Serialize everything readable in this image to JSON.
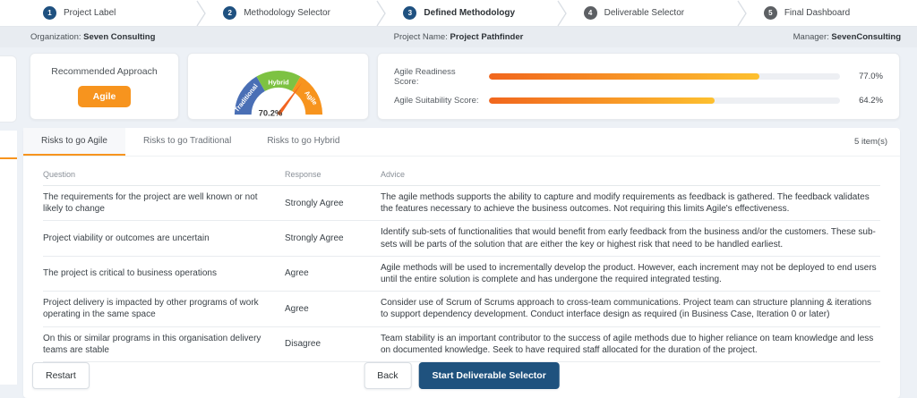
{
  "stepper": {
    "steps": [
      {
        "number": "1",
        "label": "Project Label"
      },
      {
        "number": "2",
        "label": "Methodology Selector"
      },
      {
        "number": "3",
        "label": "Defined Methodology"
      },
      {
        "number": "4",
        "label": "Deliverable Selector"
      },
      {
        "number": "5",
        "label": "Final Dashboard"
      }
    ],
    "active_index": 2
  },
  "info_bar": {
    "org_label": "Organization:",
    "org_value": "Seven Consulting",
    "project_label": "Project Name:",
    "project_value": "Project Pathfinder",
    "manager_label": "Manager:",
    "manager_value": "SevenConsulting"
  },
  "cards": {
    "recommended": {
      "title": "Recommended Approach",
      "badge": "Agile",
      "badge_color": "#f7941e"
    },
    "gauge": {
      "value": 70.2,
      "value_label": "70.2%",
      "segments": [
        {
          "label": "Traditional",
          "color": "#4a6fb5"
        },
        {
          "label": "Hybrid",
          "color": "#7dc242"
        },
        {
          "label": "Agile",
          "color": "#f7941e"
        }
      ]
    },
    "scores": {
      "items": [
        {
          "label": "Agile Readiness Score:",
          "value_label": "77.0%",
          "percent": 77.0,
          "width_css": "77%"
        },
        {
          "label": "Agile Suitability Score:",
          "value_label": "64.2%",
          "percent": 64.2,
          "width_css": "64.2%"
        }
      ]
    }
  },
  "tabs": {
    "items": [
      {
        "label": "Risks to go Agile"
      },
      {
        "label": "Risks to go Traditional"
      },
      {
        "label": "Risks to go Hybrid"
      }
    ],
    "active_index": 0,
    "count_label": "5 item(s)"
  },
  "table": {
    "headers": {
      "question": "Question",
      "response": "Response",
      "advice": "Advice"
    },
    "rows": [
      {
        "question": "The requirements for the project are well known or not likely to change",
        "response": "Strongly Agree",
        "advice": "The agile methods supports the ability to capture and modify requirements as feedback is gathered. The feedback validates the features necessary to achieve the business outcomes. Not requiring this limits Agile's effectiveness."
      },
      {
        "question": "Project viability or outcomes are uncertain",
        "response": "Strongly Agree",
        "advice": "Identify sub-sets of functionalities that would benefit from early feedback from the business and/or the customers. These sub-sets will be parts of the solution that are either the key or highest risk that need to be handled earliest."
      },
      {
        "question": "The project is critical to business operations",
        "response": "Agree",
        "advice": "Agile methods will be used to incrementally develop the product. However, each increment may not be deployed to end users until the entire solution is complete and has undergone the required integrated testing."
      },
      {
        "question": "Project delivery is impacted by other programs of work operating in the same space",
        "response": "Agree",
        "advice": "Consider use of Scrum of Scrums approach to cross-team communications. Project team can structure planning & iterations to support dependency development. Conduct interface design as required (in Business Case, Iteration 0 or later)"
      },
      {
        "question": "On this or similar programs in this organisation delivery teams are stable",
        "response": "Disagree",
        "advice": "Team stability is an important contributor to the success of agile methods due to higher reliance on team knowledge and less on documented knowledge. Seek to have required staff allocated for the duration of the project."
      }
    ]
  },
  "footer": {
    "restart_label": "Restart",
    "back_label": "Back",
    "primary_label": "Start Deliverable Selector"
  },
  "colors": {
    "accent_orange": "#f7941e",
    "navy_button": "#1f527e",
    "step_done_circle": "#1f5180",
    "step_pending_circle": "#5d6064",
    "gauge_blue": "#4a6fb5",
    "gauge_green": "#7dc242",
    "gauge_orange": "#f7941e",
    "needle_orange": "#f26522",
    "bar_gradient_start": "#f1661d",
    "bar_gradient_end": "#fdc02f"
  },
  "chart_data": [
    {
      "type": "pie",
      "subtype": "gauge-semicircle",
      "title": "Methodology gauge",
      "categories": [
        "Traditional",
        "Hybrid",
        "Agile"
      ],
      "values": [
        33.3,
        33.3,
        33.3
      ],
      "needle_value": 70.2,
      "needle_label": "70.2%",
      "range": [
        0,
        100
      ]
    },
    {
      "type": "bar",
      "categories": [
        "Agile Readiness Score",
        "Agile Suitability Score"
      ],
      "values": [
        77.0,
        64.2
      ],
      "unit": "%",
      "xlim": [
        0,
        100
      ],
      "orientation": "horizontal"
    }
  ]
}
